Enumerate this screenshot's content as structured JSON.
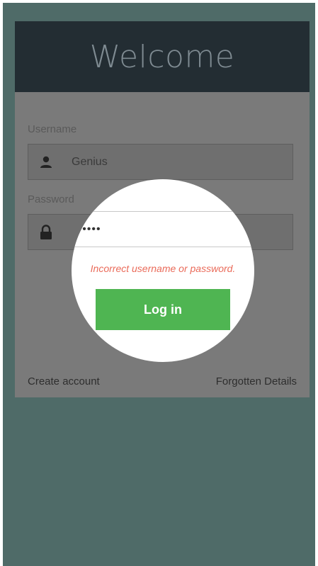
{
  "header": {
    "title": "Welcome"
  },
  "form": {
    "username_label": "Username",
    "username_value": "Genius",
    "password_label": "Password",
    "password_value": "••••••",
    "error_message": "Incorrect username or password.",
    "login_label": "Log in"
  },
  "links": {
    "create_account": "Create account",
    "forgotten_details": "Forgotten Details"
  },
  "colors": {
    "background": "#4f6b68",
    "header": "#232d33",
    "button": "#4fb552",
    "error": "#ea6b5a"
  },
  "icons": {
    "username": "person-icon",
    "password": "lock-icon"
  }
}
